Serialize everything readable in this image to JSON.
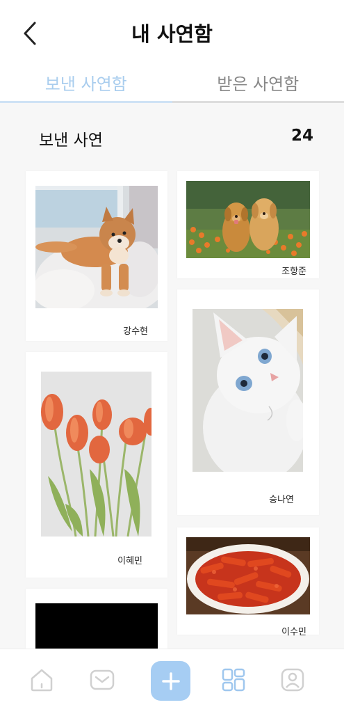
{
  "header": {
    "title": "내 사연함",
    "back_icon": "chevron-left-icon"
  },
  "tabs": [
    {
      "label": "보낸 사연함",
      "active": true
    },
    {
      "label": "받은 사연함",
      "active": false
    }
  ],
  "section": {
    "label": "보낸 사연",
    "count": "24"
  },
  "cards": [
    {
      "name": "강수현",
      "photo": "shiba-inu-dog-on-rug"
    },
    {
      "name": "조항준",
      "photo": "two-golden-retriever-puppies-in-flowers"
    },
    {
      "name": "이혜민",
      "photo": "orange-tulips"
    },
    {
      "name": "승나연",
      "photo": "white-kitten-blue-eyes"
    },
    {
      "name": "이수민",
      "photo": "tteokbokki-dish"
    },
    {
      "name": "",
      "photo": "black-image"
    }
  ],
  "bottom_nav": [
    {
      "icon": "home-icon"
    },
    {
      "icon": "mail-icon"
    },
    {
      "icon": "plus-icon"
    },
    {
      "icon": "grid-icon"
    },
    {
      "icon": "profile-icon"
    }
  ],
  "colors": {
    "accent": "#a6cdf3",
    "active_tab": "#a9cdee",
    "background": "#f7f7f7",
    "icon_gray": "#cfcfcf",
    "icon_blue": "#9fc7ee"
  }
}
